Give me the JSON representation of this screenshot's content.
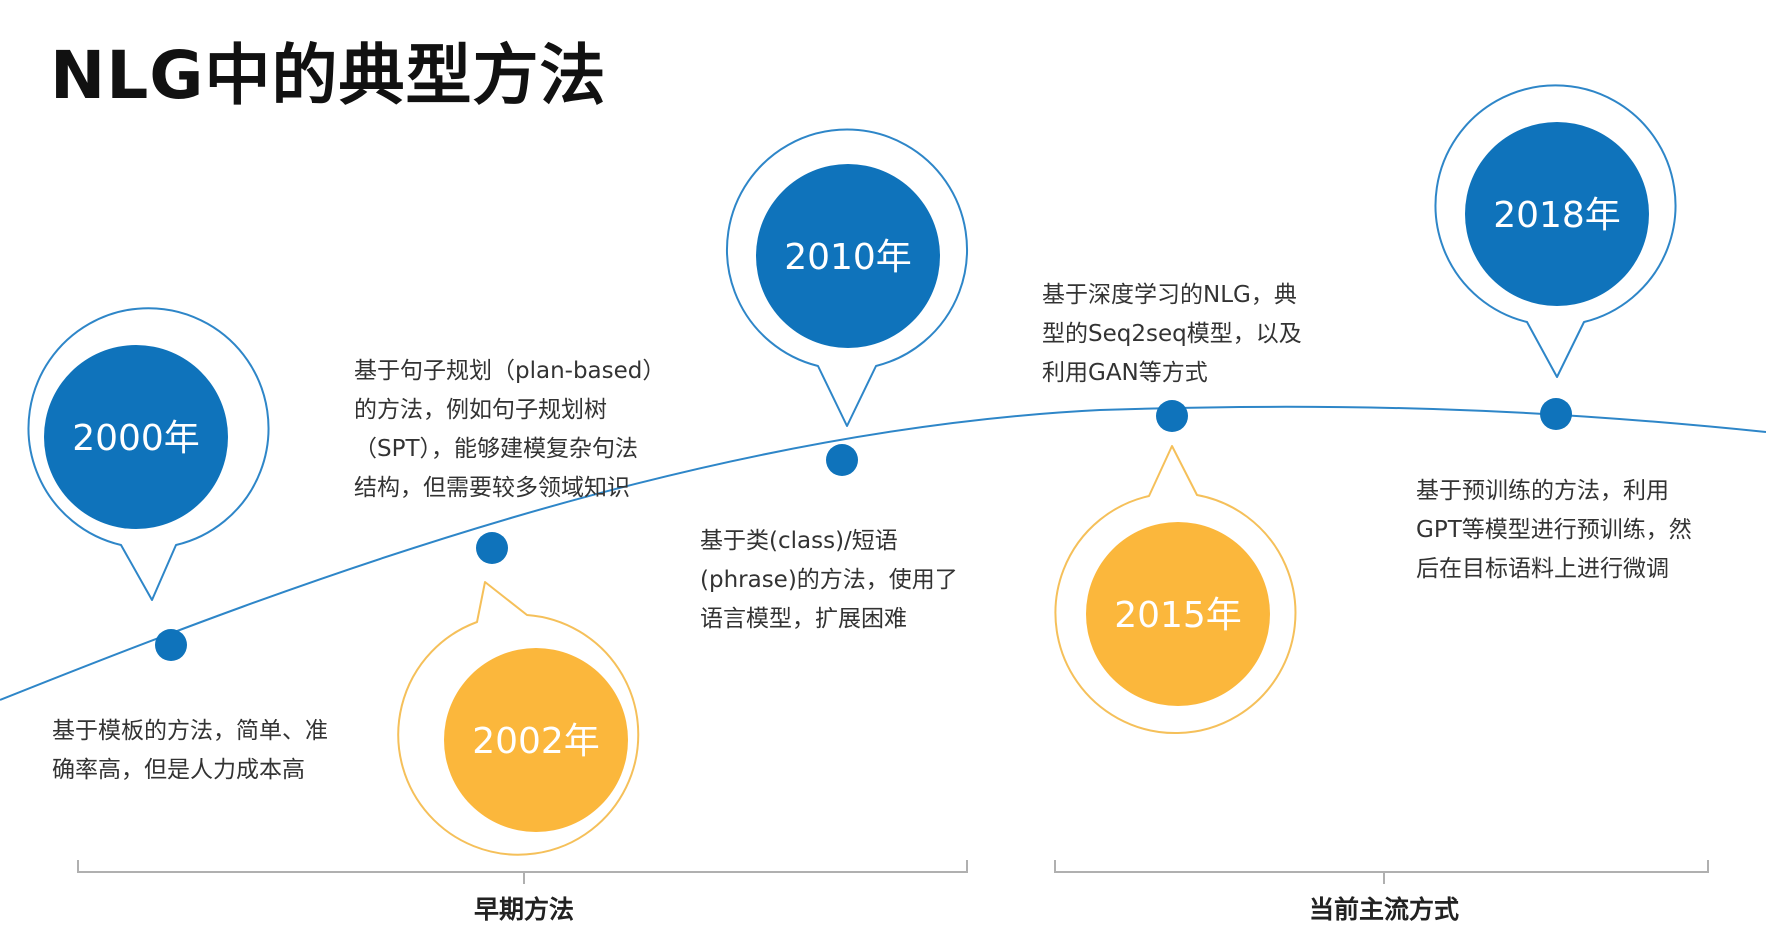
{
  "title": "NLG中的典型方法",
  "colors": {
    "blue": "#0f73bb",
    "orange": "#fbb73c",
    "line": "#2e86c8",
    "ring": "#d6e9f6"
  },
  "milestones": [
    {
      "year": "2000年",
      "color": "blue",
      "lines": [
        "基于模板的方法，简单、准",
        "确率高，但是人力成本高"
      ]
    },
    {
      "year": "2002年",
      "color": "orange",
      "lines": [
        "基于句子规划（plan-based）",
        "的方法，例如句子规划树",
        "（SPT），能够建模复杂句法",
        "结构，但需要较多领域知识"
      ]
    },
    {
      "year": "2010年",
      "color": "blue",
      "lines": [
        "基于类(class)/短语",
        "(phrase)的方法，使用了",
        "语言模型，扩展困难"
      ]
    },
    {
      "year": "2015年",
      "color": "orange",
      "lines": [
        "基于深度学习的NLG，典",
        "型的Seq2seq模型，以及",
        "利用GAN等方式"
      ]
    },
    {
      "year": "2018年",
      "color": "blue",
      "lines": [
        "基于预训练的方法，利用",
        "GPT等模型进行预训练，然",
        "后在目标语料上进行微调"
      ]
    }
  ],
  "groups": [
    {
      "label": "早期方法"
    },
    {
      "label": "当前主流方式"
    }
  ]
}
